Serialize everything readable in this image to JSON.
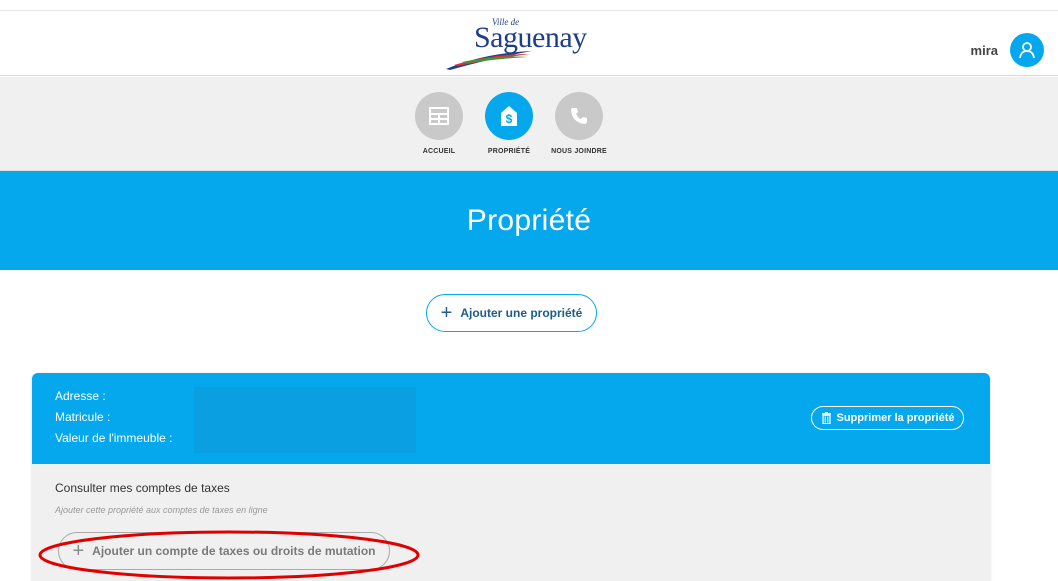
{
  "header": {
    "logo_small": "Ville de",
    "logo_main": "Saguenay",
    "user_name": "mira",
    "avatar_icon": "user-icon"
  },
  "nav": {
    "items": [
      {
        "label": "ACCUEIL",
        "icon": "home-grid-icon",
        "active": false
      },
      {
        "label": "PROPRIÉTÉ",
        "icon": "house-dollar-icon",
        "active": true
      },
      {
        "label": "NOUS JOINDRE",
        "icon": "phone-icon",
        "active": false
      }
    ]
  },
  "banner": {
    "title": "Propriété"
  },
  "add_property": {
    "plus": "+",
    "label": "Ajouter une propriété"
  },
  "property_card": {
    "address_label": "Adresse :",
    "matricule_label": "Matricule :",
    "value_label": "Valeur de l'immeuble :",
    "delete_label": "Supprimer la propriété",
    "taxes_title": "Consulter mes comptes de taxes",
    "taxes_subtitle": "Ajouter cette propriété aux comptes de taxes en ligne",
    "add_tax_plus": "+",
    "add_tax_label": "Ajouter un compte de taxes ou droits de mutation"
  },
  "colors": {
    "primary": "#05a8ec",
    "dark_blue": "#1c5d8a",
    "nav_inactive": "#c9c9c9",
    "highlight": "#e00000"
  }
}
